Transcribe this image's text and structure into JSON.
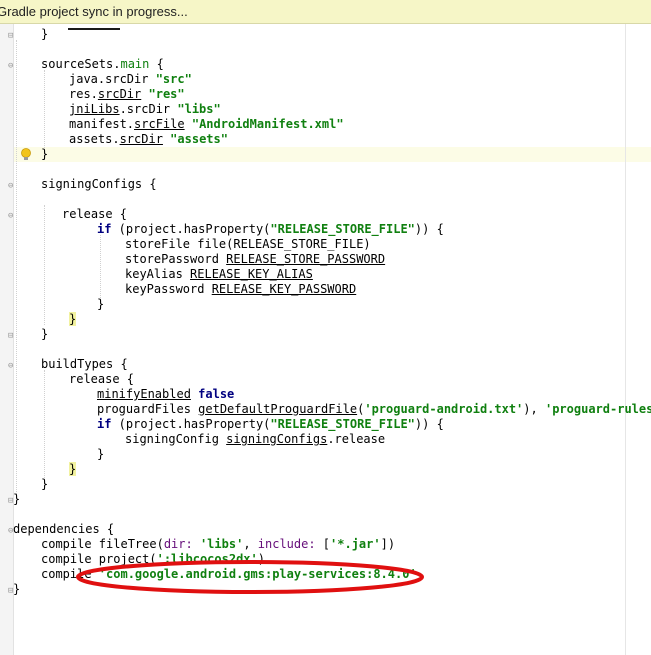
{
  "banner": {
    "text": "Gradle project sync in progress..."
  },
  "code": {
    "l01": "}",
    "l02a": "sourceSets.",
    "l02b": "main",
    "l02c": " {",
    "l03a": "java.srcDir ",
    "l03b": "\"src\"",
    "l04a": "res.",
    "l04b": "srcDir",
    "l04c": " ",
    "l04d": "\"res\"",
    "l05a": "jniLibs",
    "l05b": ".srcDir ",
    "l05c": "\"libs\"",
    "l06a": "manifest.",
    "l06b": "srcFile",
    "l06c": " ",
    "l06d": "\"AndroidManifest.xml\"",
    "l07a": "assets.",
    "l07b": "srcDir",
    "l07c": " ",
    "l07d": "\"assets\"",
    "l08": "}",
    "l09": "signingConfigs {",
    "l10": "release {",
    "l11a": "if",
    "l11b": " (project.hasProperty(",
    "l11c": "\"RELEASE_STORE_FILE\"",
    "l11d": ")) {",
    "l12a": "storeFile file(",
    "l12b": "RELEASE_STORE_FILE",
    "l12c": ")",
    "l13a": "storePassword ",
    "l13b": "RELEASE_STORE_PASSWORD",
    "l14a": "keyAlias ",
    "l14b": "RELEASE_KEY_ALIAS",
    "l15a": "keyPassword ",
    "l15b": "RELEASE_KEY_PASSWORD",
    "l16": "}",
    "l17": "}",
    "l18": "}",
    "l19": "buildTypes {",
    "l20": "release {",
    "l21a": "minifyEnabled",
    "l21b": " ",
    "l21c": "false",
    "l22a": "proguardFiles ",
    "l22b": "getDefaultProguardFile",
    "l22c": "(",
    "l22d": "'proguard-android.txt'",
    "l22e": "), ",
    "l22f": "'proguard-rules.p",
    "l23a": "if",
    "l23b": " (project.hasProperty(",
    "l23c": "\"RELEASE_STORE_FILE\"",
    "l23d": ")) {",
    "l24a": "signingConfig ",
    "l24b": "signingConfigs",
    "l24c": ".release",
    "l25": "}",
    "l26": "}",
    "l27": "}",
    "l28": "}",
    "l29": "dependencies {",
    "l30a": "compile fileTree(",
    "l30b": "dir: ",
    "l30c": "'libs'",
    "l30d": ", ",
    "l30e": "include: ",
    "l30f": "[",
    "l30g": "'*.jar'",
    "l30h": "])",
    "l31a": "compile project(",
    "l31b": "':libcocos2dx'",
    "l31c": ")",
    "l32a": "compile ",
    "l32b": "'com.google.android.gms:play-services:8.4.0'",
    "l33": "}"
  },
  "gutter_glyphs": {
    "fold_open": "⊖",
    "fold_close": "⊟"
  },
  "colors": {
    "string": "#108010",
    "keyword": "#000080",
    "annotation_ellipse": "#e01010",
    "banner_bg": "#f6f6c7"
  }
}
